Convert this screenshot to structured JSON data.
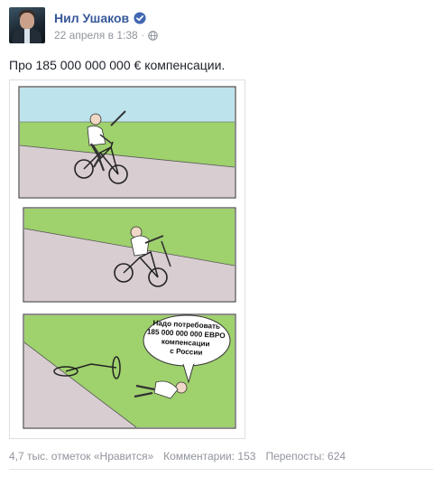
{
  "post": {
    "author": "Нил Ушаков",
    "timestamp": "22 апреля в 1:38",
    "privacy_icon": "globe-icon",
    "verified_icon": "verified-badge-icon",
    "text": "Про 185 000 000 000 € компенсации."
  },
  "meme": {
    "speech_bubble": [
      "Надо потребовать",
      "185 000 000 000 ЕВРО",
      "компенсации",
      "с России"
    ]
  },
  "stats": {
    "likes": "4,7 тыс. отметок «Нравится»",
    "comments": "Комментарии: 153",
    "shares": "Перепосты: 624"
  },
  "colors": {
    "link": "#365899",
    "verified": "#4267b2",
    "sky": "#bde3ec",
    "grass": "#9fd16d",
    "road": "#d8cdd1"
  }
}
